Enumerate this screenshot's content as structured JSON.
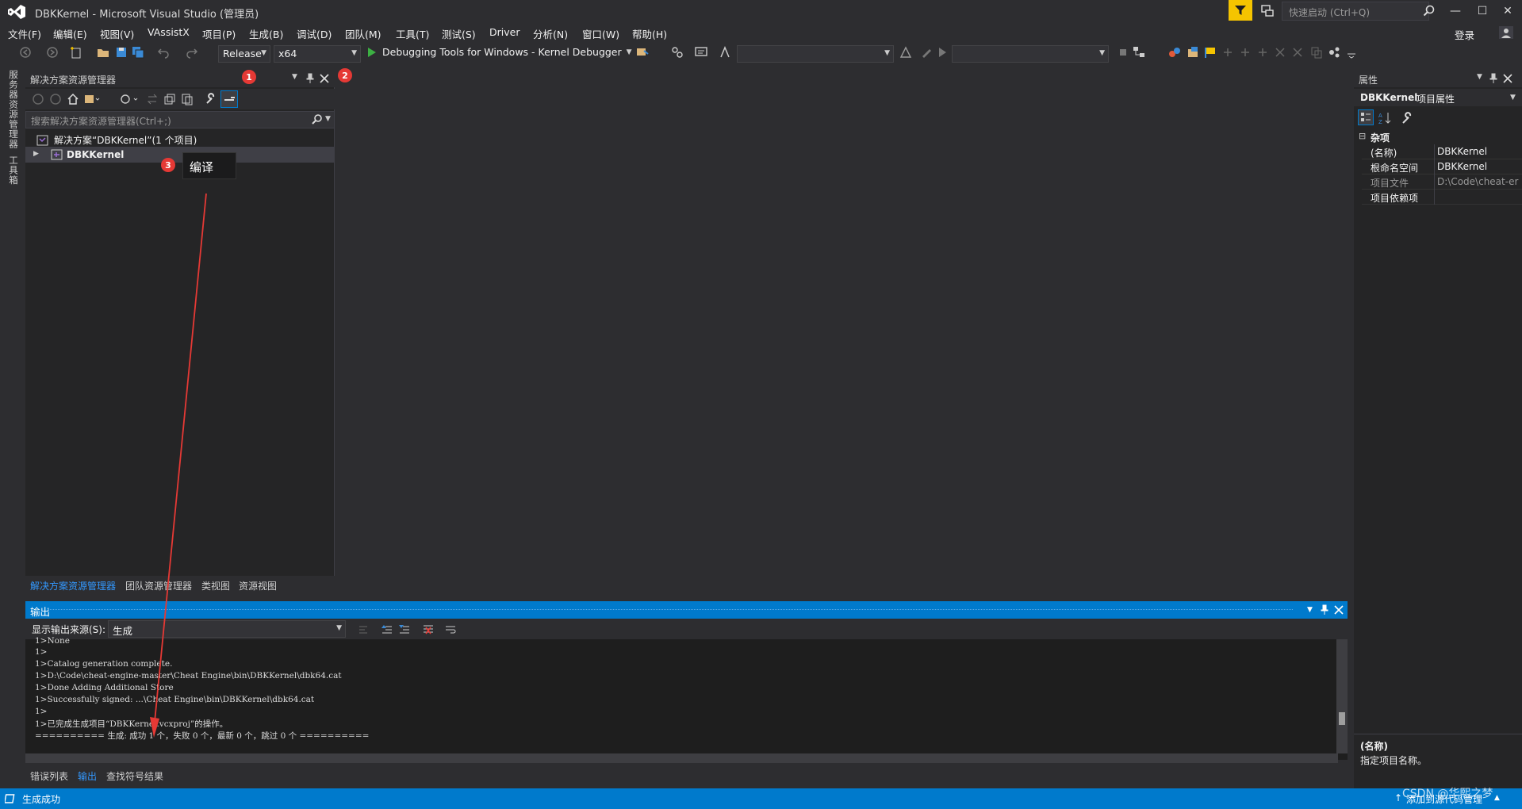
{
  "window": {
    "title": "DBKKernel - Microsoft Visual Studio (管理员)",
    "quick_launch_placeholder": "快速启动 (Ctrl+Q)",
    "minimize": "—",
    "maximize": "☐",
    "close": "✕"
  },
  "menubar": {
    "items": [
      "文件(F)",
      "编辑(E)",
      "视图(V)",
      "VAssistX",
      "项目(P)",
      "生成(B)",
      "调试(D)",
      "团队(M)",
      "工具(T)",
      "测试(S)",
      "Driver",
      "分析(N)",
      "窗口(W)",
      "帮助(H)"
    ],
    "login": "登录"
  },
  "toolbar": {
    "configuration": "Release",
    "platform": "x64",
    "debugger": "Debugging Tools for Windows - Kernel Debugger",
    "combo3": "",
    "combo4": ""
  },
  "left_rail": {
    "tabs": [
      "服务器资源管理器",
      "工具箱"
    ]
  },
  "solution_explorer": {
    "title": "解决方案资源管理器",
    "search_placeholder": "搜索解决方案资源管理器(Ctrl+;)",
    "solution_label": "解决方案“DBKKernel”(1 个项目)",
    "project_label": "DBKKernel",
    "bottom_tabs": [
      "解决方案资源管理器",
      "团队资源管理器",
      "类视图",
      "资源视图"
    ]
  },
  "output": {
    "title": "输出",
    "source_label": "显示输出来源(S):",
    "source_value": "生成",
    "lines": [
      "1>None",
      "1>",
      "1>Catalog generation complete.",
      "1>D:\\Code\\cheat-engine-master\\Cheat Engine\\bin\\DBKKernel\\dbk64.cat",
      "1>Done Adding Additional Store",
      "1>Successfully signed: ...\\Cheat Engine\\bin\\DBKKernel\\dbk64.cat",
      "1>",
      "1>已完成生成项目“DBKKernel.vcxproj”的操作。",
      "========== 生成: 成功 1 个，失败 0 个，最新 0 个，跳过 0 个 =========="
    ],
    "bottom_tabs": [
      "错误列表",
      "输出",
      "查找符号结果"
    ]
  },
  "properties": {
    "title": "属性",
    "object_name": "DBKKernel",
    "object_type": "项目属性",
    "category": "杂项",
    "rows": [
      {
        "name": "(名称)",
        "value": "DBKKernel"
      },
      {
        "name": "根命名空间",
        "value": "DBKKernel"
      },
      {
        "name": "项目文件",
        "value": "D:\\Code\\cheat-er"
      },
      {
        "name": "项目依赖项",
        "value": ""
      }
    ],
    "desc_title": "(名称)",
    "desc_text": "指定项目名称。"
  },
  "status_bar": {
    "text": "生成成功",
    "right_text": "添加到源代码管理",
    "watermark": "CSDN @华熙之梦"
  },
  "annotations": {
    "badge1": "1",
    "badge2": "2",
    "badge3": "3",
    "tooltip": "编译"
  },
  "colors": {
    "accent": "#007acc",
    "background": "#2d2d30",
    "panel": "#252526",
    "editor": "#1e1e1e",
    "annotation": "#e53935",
    "filter": "#f5c400"
  },
  "icons": [
    "vs-logo-icon",
    "filter-icon",
    "feedback-icon",
    "search-icon",
    "user-icon",
    "play-icon",
    "wrench-icon",
    "pin-icon",
    "close-icon",
    "home-icon"
  ]
}
